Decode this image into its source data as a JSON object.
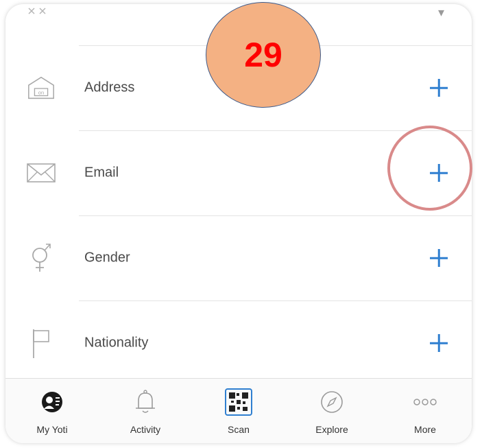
{
  "badge": {
    "number": "29"
  },
  "top_row": {
    "label": ""
  },
  "rows": [
    {
      "id": "address",
      "label": "Address",
      "icon": "house-icon"
    },
    {
      "id": "email",
      "label": "Email",
      "icon": "envelope-icon"
    },
    {
      "id": "gender",
      "label": "Gender",
      "icon": "gender-icon"
    },
    {
      "id": "nationality",
      "label": "Nationality",
      "icon": "flag-icon"
    }
  ],
  "tabs": [
    {
      "id": "my-yoti",
      "label": "My Yoti",
      "icon": "profile-icon"
    },
    {
      "id": "activity",
      "label": "Activity",
      "icon": "bell-icon"
    },
    {
      "id": "scan",
      "label": "Scan",
      "icon": "qr-code-icon"
    },
    {
      "id": "explore",
      "label": "Explore",
      "icon": "compass-icon"
    },
    {
      "id": "more",
      "label": "More",
      "icon": "ellipsis-icon"
    }
  ],
  "colors": {
    "accent": "#2f7fd0",
    "badge_fill": "#f4b183",
    "badge_text": "#ff0000",
    "highlight": "#d98a8a"
  }
}
